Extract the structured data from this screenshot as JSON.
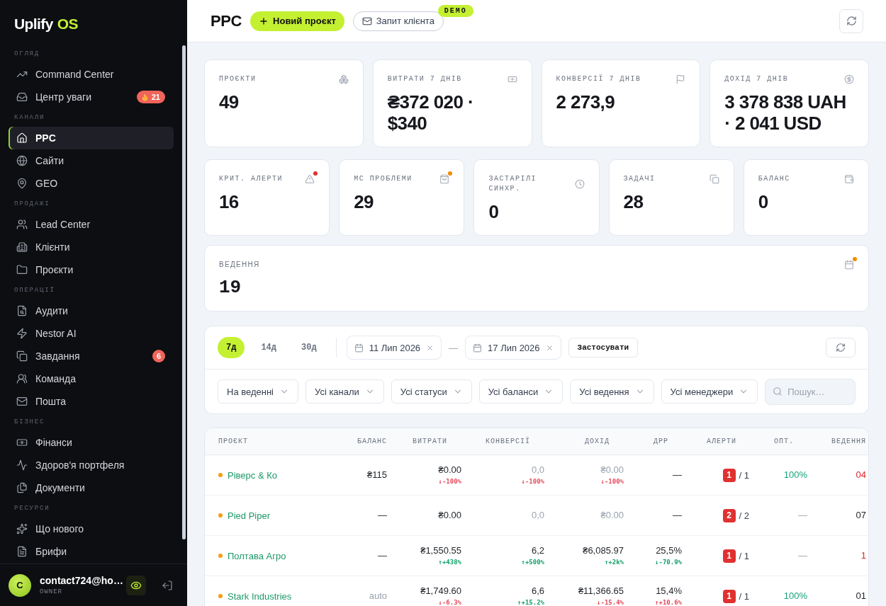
{
  "sidebar": {
    "logo": {
      "name": "Uplify",
      "accent": "OS"
    },
    "sections": [
      {
        "title": "ОГЛЯД",
        "items": [
          {
            "label": "Command Center",
            "selected": false
          },
          {
            "label": "Центр уваги",
            "selected": false,
            "badge": {
              "kind": "hot",
              "text": "21"
            }
          }
        ]
      },
      {
        "title": "КАНАЛИ",
        "items": [
          {
            "label": "PPC",
            "selected": true
          },
          {
            "label": "Сайти",
            "selected": false
          },
          {
            "label": "GEO",
            "selected": false
          }
        ]
      },
      {
        "title": "ПРОДАЖІ",
        "items": [
          {
            "label": "Lead Center",
            "selected": false
          },
          {
            "label": "Клієнти",
            "selected": false
          },
          {
            "label": "Проєкти",
            "selected": false
          }
        ]
      },
      {
        "title": "ОПЕРАЦІЇ",
        "items": [
          {
            "label": "Аудити",
            "selected": false
          },
          {
            "label": "Nestor AI",
            "selected": false
          },
          {
            "label": "Завдання",
            "selected": false,
            "badge": {
              "kind": "count",
              "text": "6"
            }
          },
          {
            "label": "Команда",
            "selected": false
          },
          {
            "label": "Пошта",
            "selected": false
          }
        ]
      },
      {
        "title": "БІЗНЕС",
        "items": [
          {
            "label": "Фінанси",
            "selected": false
          },
          {
            "label": "Здоров'я портфеля",
            "selected": false
          },
          {
            "label": "Документи",
            "selected": false
          }
        ]
      },
      {
        "title": "РЕСУРСИ",
        "items": [
          {
            "label": "Що нового",
            "selected": false
          },
          {
            "label": "Брифи",
            "selected": false
          }
        ]
      }
    ],
    "user": {
      "avatar": "C",
      "email": "contact724@ho…",
      "role": "OWNER",
      "preview_on": true
    }
  },
  "header": {
    "title": "PPC",
    "buttons": [
      {
        "kind": "primary",
        "label": "Новий проєкт"
      },
      {
        "kind": "outline",
        "label": "Запит клієнта",
        "badge": "DEMO"
      }
    ]
  },
  "stat_rows": [
    [
      {
        "label": "ПРОЄКТИ",
        "value": "49"
      },
      {
        "label": "ВИТРАТИ 7 ДНІВ",
        "value": "₴372 020 · $340"
      },
      {
        "label": "КОНВЕРСІЇ 7 ДНІВ",
        "value": "2 273,9"
      },
      {
        "label": "ДОХІД 7 ДНІВ",
        "value": "3 378 838 UAH · 2 041 USD"
      }
    ],
    [
      {
        "label": "КРИТ. АЛЕРТИ",
        "value": "16",
        "color": "#e03131"
      },
      {
        "label": "МС ПРОБЛЕМИ",
        "value": "29",
        "color": "#f08c00"
      },
      {
        "label": "ЗАСТАРІЛІ СИНХР.",
        "value": "0"
      },
      {
        "label": "ЗАДАЧІ",
        "value": "28"
      },
      {
        "label": "БАЛАНС",
        "value": "0"
      }
    ],
    [
      {
        "label": "ВЕДЕННЯ",
        "value": "19",
        "color": "#f08c00"
      }
    ]
  ],
  "filters": {
    "periods": [
      {
        "label": "7д",
        "selected": true
      },
      {
        "label": "14д",
        "selected": false
      },
      {
        "label": "30д",
        "selected": false
      }
    ],
    "date_from": "11 Лип 2026",
    "range_separator": "—",
    "date_to": "17 Лип 2026",
    "apply": "Застосувати",
    "dropdowns": [
      "На веденні",
      "Усі канали",
      "Усі статуси",
      "Усі баланси",
      "Усі ведення",
      "Усі менеджери"
    ],
    "search": {
      "placeholder": "Пошук…"
    }
  },
  "table": {
    "columns": [
      "ПРОЄКТ",
      "БАЛАНС",
      "ВИТРАТИ",
      "КОНВЕРСІЇ",
      "ДОХІД",
      "ДРР",
      "АЛЕРТИ",
      "ОПТ.",
      "ВЕДЕННЯ"
    ],
    "rows": [
      {
        "project": {
          "name": "Ріверс & Ко",
          "color": "#f59e0b"
        },
        "balance": {
          "value": "₴115",
          "muted": false
        },
        "spend": {
          "value": "₴0.00",
          "muted": false,
          "delta": {
            "text": "↓-100%",
            "good": false
          }
        },
        "conversions": {
          "value": "0,0",
          "muted": true,
          "delta": {
            "text": "↓-100%",
            "good": false
          }
        },
        "revenue": {
          "value": "₴0.00",
          "muted": true,
          "delta": {
            "text": "↓-100%",
            "good": false
          }
        },
        "drr": {
          "value": "—",
          "muted": false
        },
        "alerts": {
          "critical": "1",
          "total": "/ 1"
        },
        "optimization": {
          "value": "100%",
          "muted": false
        },
        "management": {
          "value": "04",
          "overdue": true
        }
      },
      {
        "project": {
          "name": "Pied Piper",
          "color": "#f59e0b"
        },
        "balance": {
          "value": "—",
          "muted": false
        },
        "spend": {
          "value": "₴0.00",
          "muted": false
        },
        "conversions": {
          "value": "0,0",
          "muted": true
        },
        "revenue": {
          "value": "₴0.00",
          "muted": true
        },
        "drr": {
          "value": "—",
          "muted": false
        },
        "alerts": {
          "critical": "2",
          "total": "/ 2"
        },
        "optimization": {
          "value": "—",
          "muted": true
        },
        "management": {
          "value": "07",
          "overdue": false
        }
      },
      {
        "project": {
          "name": "Полтава Агро",
          "color": "#f59e0b"
        },
        "balance": {
          "value": "—",
          "muted": false
        },
        "spend": {
          "value": "₴1,550.55",
          "muted": false,
          "delta": {
            "text": "↑+438%",
            "good": true
          }
        },
        "conversions": {
          "value": "6,2",
          "muted": false,
          "delta": {
            "text": "↑+500%",
            "good": true
          }
        },
        "revenue": {
          "value": "₴6,085.97",
          "muted": false,
          "delta": {
            "text": "↑+2k%",
            "good": true
          }
        },
        "drr": {
          "value": "25,5%",
          "muted": false,
          "delta": {
            "text": "↓-70.9%",
            "good": true
          }
        },
        "alerts": {
          "critical": "1",
          "total": "/ 1"
        },
        "optimization": {
          "value": "—",
          "muted": true
        },
        "management": {
          "value": "1",
          "overdue": true
        }
      },
      {
        "project": {
          "name": "Stark Industries",
          "color": "#f59e0b"
        },
        "balance": {
          "value": "auto",
          "muted": true
        },
        "spend": {
          "value": "₴1,749.60",
          "muted": false,
          "delta": {
            "text": "↓-6.3%",
            "good": false
          }
        },
        "conversions": {
          "value": "6,6",
          "muted": false,
          "delta": {
            "text": "↑+15.2%",
            "good": true
          }
        },
        "revenue": {
          "value": "₴11,366.65",
          "muted": false,
          "delta": {
            "text": "↓-15.4%",
            "good": false
          }
        },
        "drr": {
          "value": "15,4%",
          "muted": false,
          "delta": {
            "text": "↑+10.6%",
            "good": false
          }
        },
        "alerts": {
          "critical": "1",
          "total": "/ 1"
        },
        "optimization": {
          "value": "100%",
          "muted": false
        },
        "management": {
          "value": "01",
          "overdue": false
        }
      }
    ]
  }
}
